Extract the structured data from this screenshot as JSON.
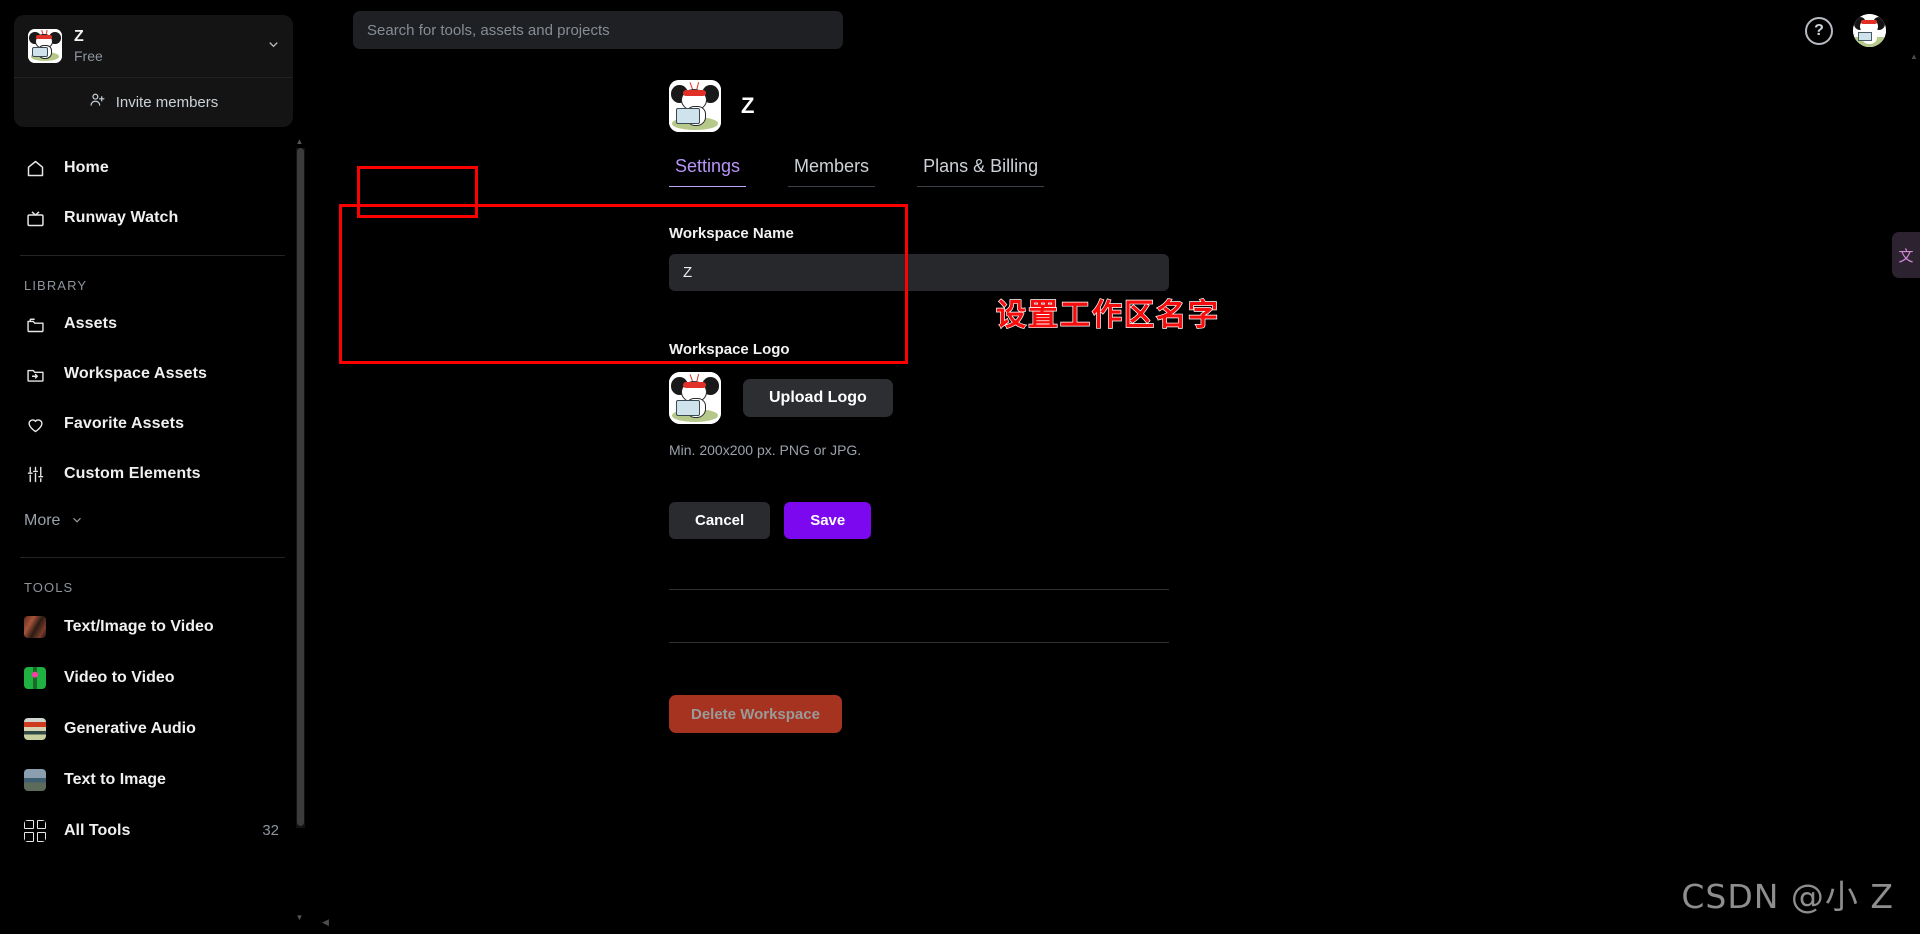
{
  "workspace": {
    "name": "Z",
    "plan": "Free",
    "invite_label": "Invite members",
    "logo_icon": "panda-reading-book-logo"
  },
  "sidebar": {
    "nav": [
      {
        "label": "Home",
        "icon": "home-icon"
      },
      {
        "label": "Runway Watch",
        "icon": "tv-icon"
      }
    ],
    "library_label": "LIBRARY",
    "library": [
      {
        "label": "Assets",
        "icon": "folder-icon"
      },
      {
        "label": "Workspace Assets",
        "icon": "folder-share-icon"
      },
      {
        "label": "Favorite Assets",
        "icon": "heart-icon"
      },
      {
        "label": "Custom Elements",
        "icon": "sliders-icon"
      }
    ],
    "more_label": "More",
    "more_icon": "chevron-down-icon",
    "tools_label": "TOOLS",
    "tools": [
      {
        "label": "Text/Image to Video",
        "icon": "thumbnail-text-image-to-video"
      },
      {
        "label": "Video to Video",
        "icon": "thumbnail-video-to-video"
      },
      {
        "label": "Generative Audio",
        "icon": "thumbnail-generative-audio"
      },
      {
        "label": "Text to Image",
        "icon": "thumbnail-text-to-image"
      },
      {
        "label": "All Tools",
        "icon": "grid-icon",
        "count": "32"
      }
    ]
  },
  "topbar": {
    "search_placeholder": "Search for tools, assets and projects",
    "search_value": "",
    "search_icon": "search-input",
    "help_icon": "question-mark-icon",
    "help_label": "?",
    "avatar_icon": "user-avatar"
  },
  "header": {
    "title": "Z"
  },
  "tabs": [
    {
      "label": "Settings",
      "active": true
    },
    {
      "label": "Members",
      "active": false
    },
    {
      "label": "Plans & Billing",
      "active": false
    }
  ],
  "settings": {
    "name_label": "Workspace Name",
    "name_value": "Z",
    "name_placeholder": "Workspace Name",
    "logo_label": "Workspace Logo",
    "upload_label": "Upload Logo",
    "logo_hint": "Min. 200x200 px. PNG or JPG.",
    "cancel_label": "Cancel",
    "save_label": "Save",
    "delete_label": "Delete Workspace"
  },
  "annotations": {
    "callout_text": "设置工作区名字",
    "callout_color": "#f60c0c",
    "box_color": "#fe0000"
  },
  "watermark": "CSDN @小 Z",
  "side_widget": {
    "icon": "translate-icon",
    "glyph": "文"
  },
  "colors": {
    "accent_purple": "#7c08f0",
    "tab_active": "#b794f6",
    "danger_red": "#a5331f",
    "background": "#000000",
    "panel": "#141414"
  }
}
